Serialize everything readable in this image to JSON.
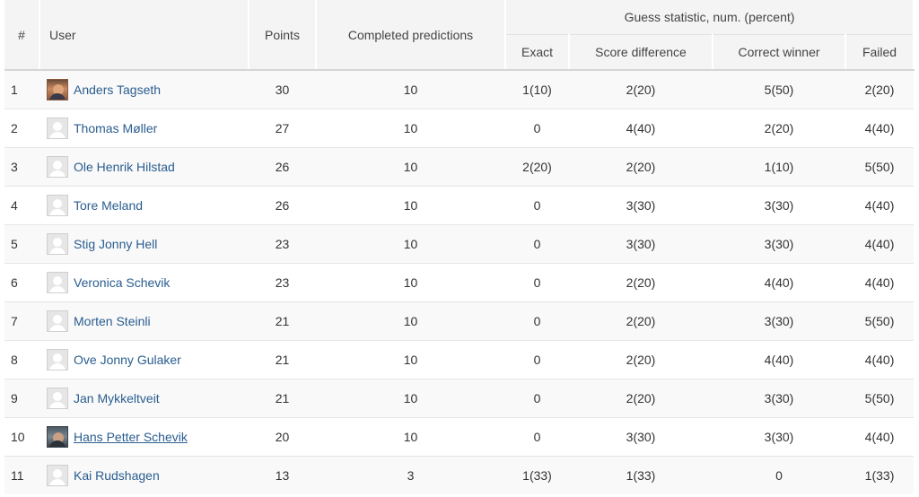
{
  "table": {
    "headers": {
      "rank": "#",
      "user": "User",
      "points": "Points",
      "completed": "Completed predictions",
      "group": "Guess statistic, num. (percent)",
      "exact": "Exact",
      "score_difference": "Score difference",
      "correct_winner": "Correct winner",
      "failed": "Failed"
    },
    "rows": [
      {
        "rank": "1",
        "name": "Anders Tagseth",
        "avatar": "photo",
        "points": "30",
        "completed": "10",
        "exact": "1(10)",
        "score_difference": "2(20)",
        "correct_winner": "5(50)",
        "failed": "2(20)"
      },
      {
        "rank": "2",
        "name": "Thomas Møller",
        "avatar": "default",
        "points": "27",
        "completed": "10",
        "exact": "0",
        "score_difference": "4(40)",
        "correct_winner": "2(20)",
        "failed": "4(40)"
      },
      {
        "rank": "3",
        "name": "Ole Henrik Hilstad",
        "avatar": "default",
        "points": "26",
        "completed": "10",
        "exact": "2(20)",
        "score_difference": "2(20)",
        "correct_winner": "1(10)",
        "failed": "5(50)"
      },
      {
        "rank": "4",
        "name": "Tore Meland",
        "avatar": "default",
        "points": "26",
        "completed": "10",
        "exact": "0",
        "score_difference": "3(30)",
        "correct_winner": "3(30)",
        "failed": "4(40)"
      },
      {
        "rank": "5",
        "name": "Stig Jonny Hell",
        "avatar": "default",
        "points": "23",
        "completed": "10",
        "exact": "0",
        "score_difference": "3(30)",
        "correct_winner": "3(30)",
        "failed": "4(40)"
      },
      {
        "rank": "6",
        "name": "Veronica Schevik",
        "avatar": "default",
        "points": "23",
        "completed": "10",
        "exact": "0",
        "score_difference": "2(20)",
        "correct_winner": "4(40)",
        "failed": "4(40)"
      },
      {
        "rank": "7",
        "name": "Morten Steinli",
        "avatar": "default",
        "points": "21",
        "completed": "10",
        "exact": "0",
        "score_difference": "2(20)",
        "correct_winner": "3(30)",
        "failed": "5(50)"
      },
      {
        "rank": "8",
        "name": "Ove Jonny Gulaker",
        "avatar": "default",
        "points": "21",
        "completed": "10",
        "exact": "0",
        "score_difference": "2(20)",
        "correct_winner": "4(40)",
        "failed": "4(40)"
      },
      {
        "rank": "9",
        "name": "Jan Mykkeltveit",
        "avatar": "default",
        "points": "21",
        "completed": "10",
        "exact": "0",
        "score_difference": "2(20)",
        "correct_winner": "3(30)",
        "failed": "5(50)"
      },
      {
        "rank": "10",
        "name": "Hans Petter Schevik",
        "avatar": "photo",
        "points": "20",
        "completed": "10",
        "exact": "0",
        "score_difference": "3(30)",
        "correct_winner": "3(30)",
        "failed": "4(40)"
      },
      {
        "rank": "11",
        "name": "Kai Rudshagen",
        "avatar": "default",
        "points": "13",
        "completed": "3",
        "exact": "1(33)",
        "score_difference": "1(33)",
        "correct_winner": "0",
        "failed": "1(33)"
      }
    ]
  },
  "colors": {
    "link": "#2a5d8f",
    "header_bg": "#f4f4f4",
    "row_stripe": "#f9f9f9"
  }
}
